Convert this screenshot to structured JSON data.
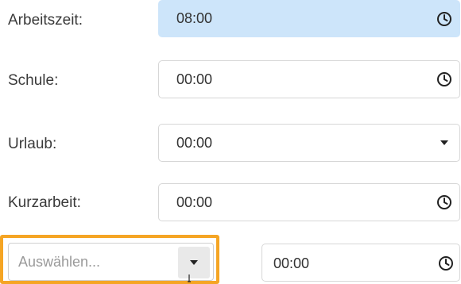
{
  "rows": [
    {
      "label": "Arbeitszeit:",
      "value": "08:00",
      "icon": "clock-icon"
    },
    {
      "label": "Schule:",
      "value": "00:00",
      "icon": "clock-icon"
    },
    {
      "label": "Urlaub:",
      "value": "00:00",
      "icon": "chevron-down-icon"
    },
    {
      "label": "Kurzarbeit:",
      "value": "00:00",
      "icon": "clock-icon"
    }
  ],
  "extra_row": {
    "select_placeholder": "Auswählen...",
    "value": "00:00",
    "icon": "clock-icon"
  },
  "colors": {
    "highlight": "#cde5fa",
    "focus": "#f5a524"
  }
}
